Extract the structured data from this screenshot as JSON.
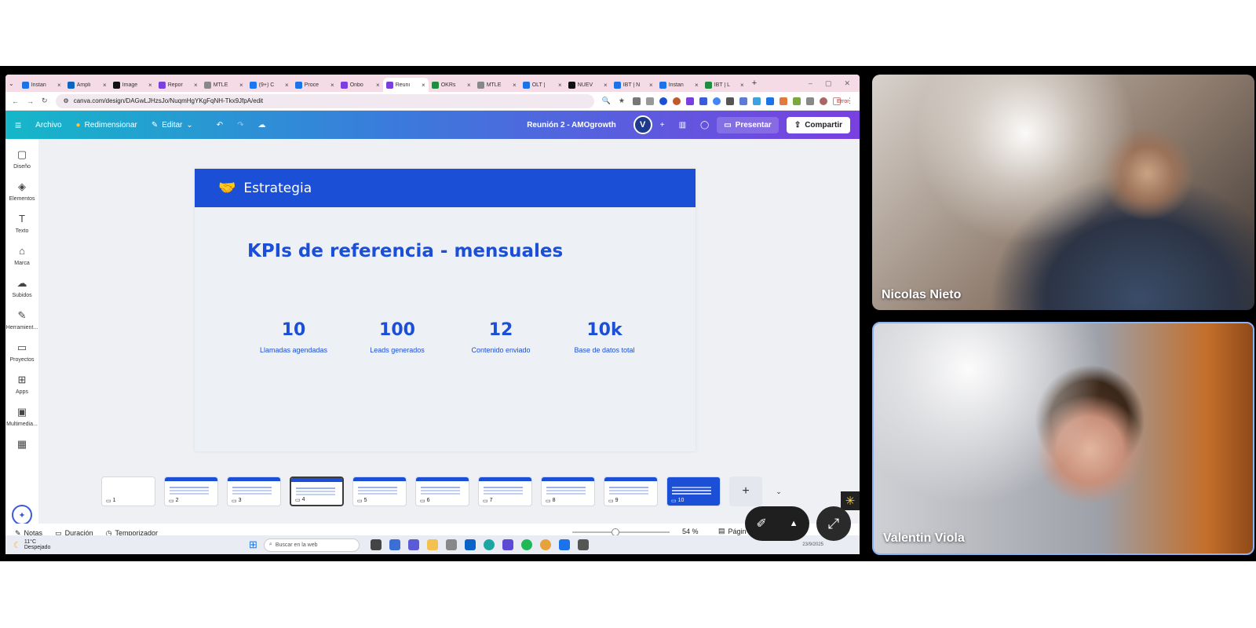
{
  "browser": {
    "tabs": [
      {
        "label": "Instan",
        "color": "#1a73e8"
      },
      {
        "label": "Ampli",
        "color": "#0a66c2"
      },
      {
        "label": "Image",
        "color": "#111111"
      },
      {
        "label": "Repor",
        "color": "#7a3fe0"
      },
      {
        "label": "MTLE",
        "color": "#888888"
      },
      {
        "label": "(9+) C",
        "color": "#1877f2"
      },
      {
        "label": "Proce",
        "color": "#1a73e8"
      },
      {
        "label": "Onbo",
        "color": "#7a3fe0"
      },
      {
        "label": "Reuni",
        "color": "#7a3fe0",
        "active": true
      },
      {
        "label": "OKRs",
        "color": "#1e8e3e"
      },
      {
        "label": "MTLE",
        "color": "#888888"
      },
      {
        "label": "OLT |",
        "color": "#1a73e8"
      },
      {
        "label": "NUEV",
        "color": "#111111"
      },
      {
        "label": "IBT | N",
        "color": "#1a73e8"
      },
      {
        "label": "Instan",
        "color": "#1a73e8"
      },
      {
        "label": "IBT | L",
        "color": "#1e8e3e"
      }
    ],
    "url": "canva.com/design/DAGwLJHzsJo/NuqmHgYKgFqNH-Tkx9JfpA/edit",
    "error_label": "Error"
  },
  "canva": {
    "menu": {
      "file": "Archivo",
      "resize": "Redimensionar",
      "edit": "Editar"
    },
    "doc_title": "Reunión 2 - AMOgrowth",
    "avatar_initial": "V",
    "present": "Presentar",
    "share": "Compartir",
    "rail": [
      {
        "label": "Diseño",
        "icon": "▢"
      },
      {
        "label": "Elementos",
        "icon": "◈"
      },
      {
        "label": "Texto",
        "icon": "T"
      },
      {
        "label": "Marca",
        "icon": "⌂"
      },
      {
        "label": "Subidos",
        "icon": "☁"
      },
      {
        "label": "Herramient...",
        "icon": "✎"
      },
      {
        "label": "Proyectos",
        "icon": "▭"
      },
      {
        "label": "Apps",
        "icon": "⊞"
      },
      {
        "label": "Multimedia...",
        "icon": "▣"
      },
      {
        "label": "",
        "icon": "▦"
      }
    ],
    "slide": {
      "header": "Estrategia",
      "title": "KPIs de referencia - mensuales",
      "kpis": [
        {
          "value": "10",
          "label": "Llamadas agendadas"
        },
        {
          "value": "100",
          "label": "Leads generados"
        },
        {
          "value": "12",
          "label": "Contenido enviado"
        },
        {
          "value": "10k",
          "label": "Base de datos total"
        }
      ]
    },
    "pages": [
      "1",
      "2",
      "3",
      "4",
      "5",
      "6",
      "7",
      "8",
      "9",
      "10"
    ],
    "selected_page": "4",
    "bottom": {
      "notes": "Notas",
      "duration": "Duración",
      "timer": "Temporizador",
      "zoom": "54 %",
      "pages_label": "Págin"
    }
  },
  "taskbar": {
    "temp": "11°C",
    "weather": "Despejado",
    "search_placeholder": "Buscar en la web",
    "date": "23/9/2025"
  },
  "participants": [
    {
      "name": "Nicolas Nieto"
    },
    {
      "name": "Valentin Viola"
    }
  ]
}
